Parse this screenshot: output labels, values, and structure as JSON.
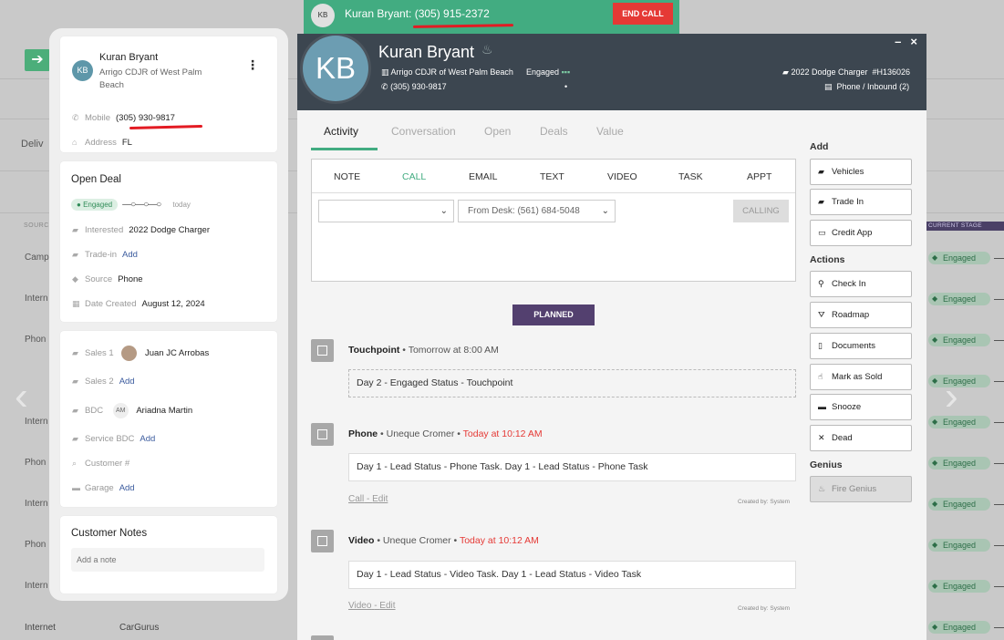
{
  "background": {
    "delivered_label": "Deliv",
    "source_header": "SOURCE",
    "current_stage_header": "CURRENT STAGE",
    "left_col_values": [
      "Camp",
      "Intern",
      "Phon",
      "Intern",
      "Intern",
      "Phon",
      "Intern",
      "Phon",
      "Intern"
    ],
    "badge_label": "Engaged",
    "bottom_row": {
      "source": "Internet",
      "provider": "CarGurus"
    }
  },
  "call_bar": {
    "avatar_initials": "KB",
    "caller_text": "Kuran Bryant: (305) 915-2372",
    "end_call_label": "END CALL"
  },
  "contact_card": {
    "initials": "KB",
    "name": "Kuran Bryant",
    "dealer": "Arrigo CDJR of West Palm Beach",
    "mobile_label": "Mobile",
    "mobile_value": "(305) 930-9817",
    "address_label": "Address",
    "address_value": "FL"
  },
  "open_deal": {
    "title": "Open Deal",
    "status": "Engaged",
    "progress": "—○—○—○",
    "when": "today",
    "interested_label": "Interested",
    "interested_value": "2022 Dodge Charger",
    "tradein_label": "Trade-in",
    "tradein_value": "Add",
    "source_label": "Source",
    "source_value": "Phone",
    "date_label": "Date Created",
    "date_value": "August 12, 2024"
  },
  "team": {
    "sales1_label": "Sales 1",
    "sales1_value": "Juan JC Arrobas",
    "sales2_label": "Sales 2",
    "sales2_value": "Add",
    "bdc_label": "BDC",
    "bdc_initials": "AM",
    "bdc_value": "Ariadna Martin",
    "service_label": "Service BDC",
    "service_value": "Add",
    "customer_label": "Customer #",
    "garage_label": "Garage",
    "garage_value": "Add"
  },
  "notes": {
    "title": "Customer Notes",
    "placeholder": "Add a note"
  },
  "modal": {
    "initials": "KB",
    "name": "Kuran Bryant",
    "dealer": "Arrigo CDJR of West Palm Beach",
    "status": "Engaged",
    "phone": "(305) 930-9817",
    "vehicle": "2022 Dodge Charger",
    "stock": "#H136026",
    "call_type": "Phone / Inbound (2)",
    "minimize": "–",
    "close": "×"
  },
  "tabs": [
    "Activity",
    "Conversation",
    "Open",
    "Deals",
    "Value"
  ],
  "composer": {
    "tabs": [
      "NOTE",
      "CALL",
      "EMAIL",
      "TEXT",
      "VIDEO",
      "TASK",
      "APPT"
    ],
    "select1_value": "",
    "select2_value": "From Desk: (561) 684-5048",
    "calling_label": "CALLING"
  },
  "planned_label": "PLANNED",
  "tasks": [
    {
      "type": "Touchpoint",
      "meta": "Tomorrow at 8:00 AM",
      "body": "Day 2 - Engaged Status - Touchpoint"
    },
    {
      "type": "Phone",
      "assignee": "Uneque Cromer",
      "when": "Today at 10:12 AM",
      "body": "Day 1 - Lead Status - Phone Task. Day 1 - Lead Status - Phone Task",
      "link1": "Call",
      "link2": "Edit",
      "created_by": "Created by: System"
    },
    {
      "type": "Video",
      "assignee": "Uneque Cromer",
      "when": "Today at 10:12 AM",
      "body": "Day 1 - Lead Status - Video Task. Day 1 - Lead Status - Video Task",
      "link1": "Video",
      "link2": "Edit",
      "created_by": "Created by: System"
    }
  ],
  "sidebar": {
    "add_heading": "Add",
    "add_items": [
      "Vehicles",
      "Trade In",
      "Credit App"
    ],
    "actions_heading": "Actions",
    "action_items": [
      "Check In",
      "Roadmap",
      "Documents",
      "Mark as Sold",
      "Snooze",
      "Dead"
    ],
    "genius_heading": "Genius",
    "genius_item": "Fire Genius"
  }
}
